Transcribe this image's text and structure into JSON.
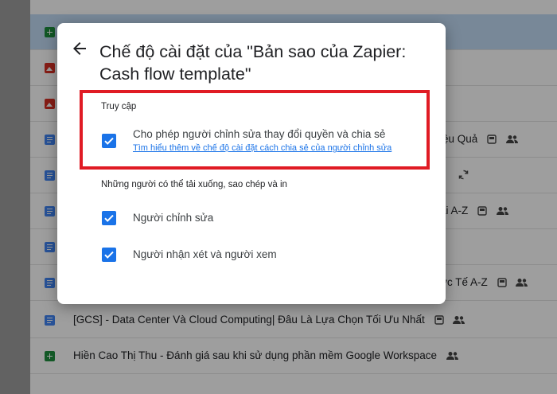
{
  "background_list": {
    "rows": [
      {
        "type": "sheet",
        "selected": true,
        "text": "",
        "tail": ""
      },
      {
        "type": "image",
        "text": "",
        "tail": ""
      },
      {
        "type": "image",
        "text": "",
        "tail": ""
      },
      {
        "type": "doc",
        "text": "",
        "tail": "iệu Quả"
      },
      {
        "type": "doc",
        "text": "",
        "tail": ""
      },
      {
        "type": "doc",
        "text": "",
        "tail": "ại A-Z"
      },
      {
        "type": "doc",
        "text": "",
        "tail": ""
      },
      {
        "type": "doc",
        "text": "",
        "tail": "ực Tế A-Z"
      },
      {
        "type": "doc",
        "text": "[GCS] - Data Center Và Cloud Computing| Đâu Là Lựa Chọn Tối Ưu Nhất",
        "tail": ""
      },
      {
        "type": "sheet",
        "text": "Hiền Cao Thị Thu - Đánh giá sau khi sử dụng phần mềm Google Workspace",
        "tail": ""
      }
    ]
  },
  "dialog": {
    "title": "Chế độ cài đặt của \"Bản sao của Zapier: Cash flow template\"",
    "access_section": {
      "label": "Truy cập",
      "option": {
        "label": "Cho phép người chỉnh sửa thay đổi quyền và chia sẻ",
        "checked": true,
        "link": "Tìm hiểu thêm về chế độ cài đặt cách chia sẻ của người chỉnh sửa"
      }
    },
    "download_section": {
      "label": "Những người có thể tải xuống, sao chép và in",
      "options": [
        {
          "label": "Người chỉnh sửa",
          "checked": true
        },
        {
          "label": "Người nhận xét và người xem",
          "checked": true
        }
      ]
    }
  },
  "colors": {
    "accent": "#1a73e8",
    "highlight": "#e01b24"
  }
}
